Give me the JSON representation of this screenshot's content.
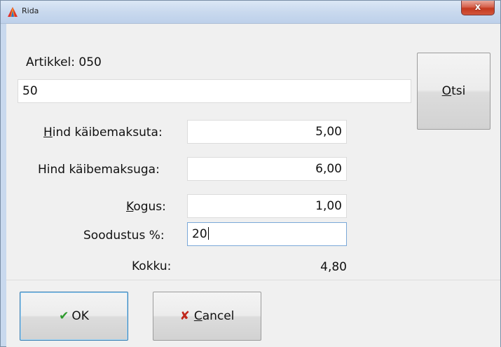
{
  "window": {
    "title": "Rida",
    "close_glyph": "x"
  },
  "article": {
    "label": "Artikkel:",
    "code": "050",
    "search_value": "50",
    "search_button": {
      "mnemonic": "O",
      "rest": "tsi"
    }
  },
  "fields": {
    "price_excl_vat": {
      "mnemonic": "H",
      "label_rest": "ind käibemaksuta:",
      "value": "5,00"
    },
    "price_incl_vat": {
      "label": "Hind käibemaksuga:",
      "value": "6,00"
    },
    "quantity": {
      "mnemonic": "K",
      "label_rest": "ogus:",
      "value": "1,00"
    },
    "discount": {
      "label": "Soodustus %:",
      "value": "20"
    },
    "total": {
      "label": "Kokku:",
      "value": "4,80"
    }
  },
  "buttons": {
    "ok": {
      "label": "OK",
      "icon": "check-icon"
    },
    "cancel": {
      "mnemonic": "C",
      "rest": "ancel",
      "icon": "x-icon"
    }
  },
  "colors": {
    "ok_icon": "#2e9a2e",
    "cancel_icon": "#c0271b",
    "close_button": "#c4391f"
  }
}
